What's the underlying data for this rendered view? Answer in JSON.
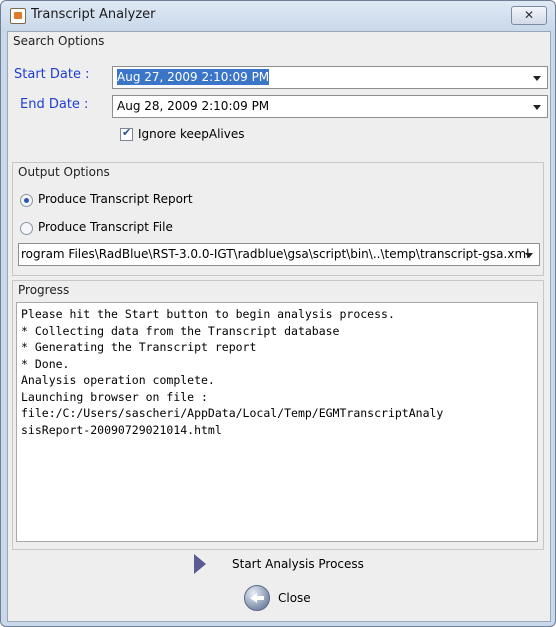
{
  "window": {
    "title": "Transcript Analyzer",
    "close_glyph": "✕"
  },
  "search_options": {
    "title": "Search Options",
    "start_label": "Start Date :",
    "start_value": "Aug 27, 2009 2:10:09 PM",
    "end_label": "End Date :",
    "end_value": "Aug 28, 2009 2:10:09 PM",
    "ignore_keepalives_label": "Ignore keepAlives",
    "ignore_keepalives_checked": true
  },
  "output_options": {
    "title": "Output Options",
    "radio_report_label": "Produce Transcript Report",
    "radio_file_label": "Produce Transcript File",
    "selected": "report",
    "path_value": "rogram Files\\RadBlue\\RST-3.0.0-IGT\\radblue\\gsa\\script\\bin\\..\\temp\\transcript-gsa.xml"
  },
  "progress": {
    "title": "Progress",
    "lines": [
      "Please hit the Start button to begin analysis process.",
      "* Collecting data from the Transcript database",
      "* Generating the Transcript report",
      "* Done.",
      "Analysis operation complete.",
      "Launching browser on file :",
      "file:/C:/Users/sascheri/AppData/Local/Temp/EGMTranscriptAnaly",
      "sisReport-20090729021014.html"
    ]
  },
  "actions": {
    "start_label": "Start Analysis Process",
    "close_label": "Close"
  }
}
